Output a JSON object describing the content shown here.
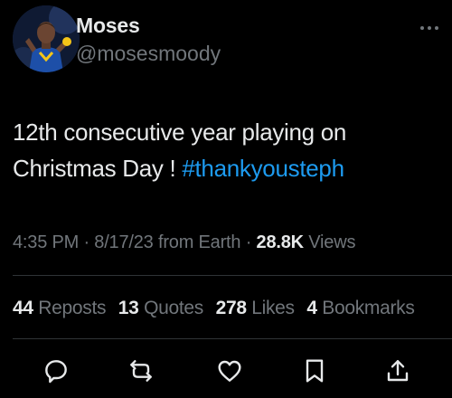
{
  "author": {
    "display_name": "Moses",
    "handle": "@mosesmoody"
  },
  "post": {
    "text": "12th consecutive year playing on Christmas Day ! ",
    "hashtag": "#thankyousteph"
  },
  "meta": {
    "time": "4:35 PM",
    "separator1": " · ",
    "date": "8/17/23",
    "source": " from Earth",
    "separator2": " · ",
    "views_count": "28.8K",
    "views_label": " Views"
  },
  "stats": {
    "reposts_count": "44",
    "reposts_label": " Reposts",
    "quotes_count": "13",
    "quotes_label": " Quotes",
    "likes_count": "278",
    "likes_label": " Likes",
    "bookmarks_count": "4",
    "bookmarks_label": " Bookmarks"
  },
  "icons": {
    "more": "more-horizontal-icon",
    "reply": "reply-icon",
    "repost": "repost-icon",
    "like": "like-icon",
    "bookmark": "bookmark-icon",
    "share": "share-icon"
  },
  "colors": {
    "background": "#000000",
    "text_primary": "#e7e9ea",
    "text_secondary": "#71767b",
    "link": "#1d9bf0",
    "divider": "#2f3336"
  }
}
